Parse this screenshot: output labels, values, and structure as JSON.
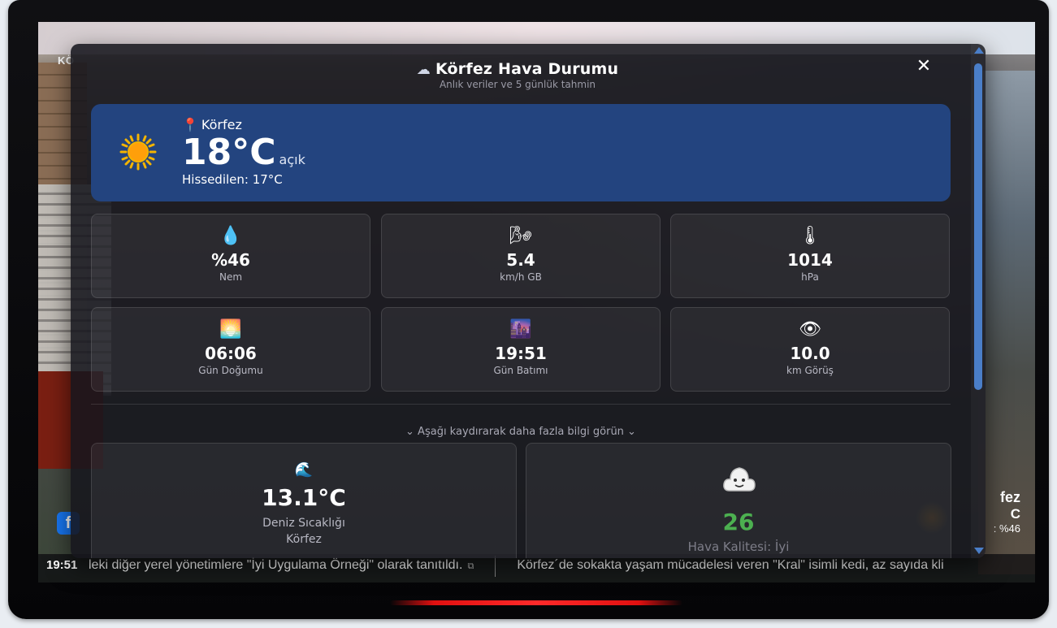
{
  "overlay": {
    "corner_label": "KÖ",
    "facebook_icon": "f",
    "mini_weather": {
      "city": "fez",
      "temp": "C",
      "humidity": ": %46"
    }
  },
  "ticker": {
    "time": "19:51",
    "items": [
      "leki diğer yerel yönetimlere \"İyi Uygulama Örneği\" olarak tanıtıldı.",
      "Körfez´de sokakta yaşam mücadelesi veren \"Kral\" isimli kedi, az sayıda kli"
    ]
  },
  "modal": {
    "title_icon": "☁",
    "title": "Körfez Hava Durumu",
    "subtitle": "Anlık veriler ve 5 günlük tahmin",
    "close": "✕",
    "current": {
      "location": "Körfez",
      "temperature": "18°C",
      "condition": "açık",
      "feels_like": "Hissedilen: 17°C"
    },
    "stats": [
      {
        "icon": "💧",
        "icon_name": "droplet-icon",
        "value": "%46",
        "label": "Nem"
      },
      {
        "icon": "🌬",
        "icon_name": "wind-icon",
        "value": "5.4",
        "label": "km/h GB"
      },
      {
        "icon": "🌡",
        "icon_name": "thermometer-icon",
        "value": "1014",
        "label": "hPa"
      },
      {
        "icon": "🌅",
        "icon_name": "sunrise-icon",
        "value": "06:06",
        "label": "Gün Doğumu"
      },
      {
        "icon": "🌆",
        "icon_name": "sunset-icon",
        "value": "19:51",
        "label": "Gün Batımı"
      },
      {
        "icon": "👁",
        "icon_name": "eye-icon",
        "value": "10.0",
        "label": "km Görüş"
      }
    ],
    "scroll_hint": "⌄ Aşağı kaydırarak daha fazla bilgi görün ⌄",
    "sea": {
      "icon": "🌊",
      "value": "13.1°C",
      "label": "Deniz Sıcaklığı",
      "sub": "Körfez"
    },
    "air": {
      "value": "26",
      "label": "Hava Kalitesi: İyi",
      "color": "#4cb050"
    }
  },
  "colors": {
    "accent": "#4a7ec8",
    "current_bg": "#23447f",
    "led": "#ff2a2a"
  }
}
